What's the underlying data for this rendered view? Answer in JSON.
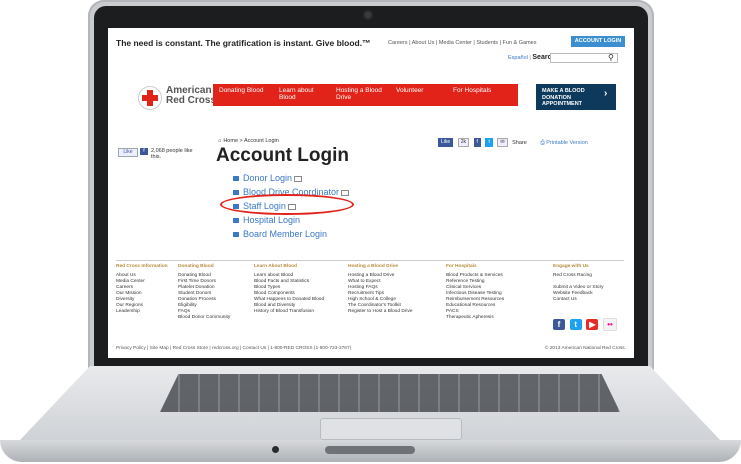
{
  "site": {
    "tagline": "The need is constant. The gratification is instant. Give blood.™",
    "top_links": "Careers | About Us | Media Center | Students | Fun & Games",
    "account_login": "ACCOUNT LOGIN",
    "espanol": "Español",
    "search_label": "Search",
    "logo_line1": "American",
    "logo_line2": "Red Cross",
    "nav": [
      {
        "label": "Donating Blood"
      },
      {
        "label": "Learn about Blood"
      },
      {
        "label": "Hosting a Blood Drive"
      },
      {
        "label": "Volunteer"
      },
      {
        "label": "For Hospitals"
      }
    ],
    "cta": "MAKE A BLOOD DONATION APPOINTMENT",
    "fb_like": "Like",
    "people_like": "2,068 people like this.",
    "breadcrumb": "Home > Account Login",
    "page_title": "Account Login",
    "share": {
      "like": "Like",
      "count": "2k",
      "share": "Share",
      "printable": "Printable Version"
    },
    "login_options": [
      {
        "label": "Donor Login"
      },
      {
        "label": "Blood Drive Coordinator"
      },
      {
        "label": "Staff Login"
      },
      {
        "label": "Hospital Login"
      },
      {
        "label": "Board Member Login"
      }
    ],
    "footer": {
      "columns": [
        {
          "head": "Red Cross Information",
          "items": [
            "About Us",
            "Media Center",
            "Careers",
            "Our Mission",
            "Diversity",
            "Our Regions",
            "Leadership"
          ]
        },
        {
          "head": "Donating Blood",
          "items": [
            "Donating Blood",
            "First Time Donors",
            "Platelet Donation",
            "Student Donors",
            "Donation Process",
            "Eligibility",
            "FAQs",
            "Blood Donor Community"
          ]
        },
        {
          "head": "Learn About Blood",
          "items": [
            "Learn about Blood",
            "Blood Facts and Statistics",
            "Blood Types",
            "Blood Components",
            "What Happens to Donated Blood",
            "Blood and Diversity",
            "History of Blood Transfusion"
          ]
        },
        {
          "head": "Hosting a Blood Drive",
          "items": [
            "Hosting a Blood Drive",
            "What to Expect",
            "Hosting FAQs",
            "Recruitment Tips",
            "High School & College",
            "The Coordinator's Toolkit",
            "Register to Host a Blood Drive"
          ]
        },
        {
          "head": "For Hospitals",
          "items": [
            "Blood Products & Services",
            "Reference Testing",
            "Clinical Services",
            "Infectious Disease Testing",
            "Reimbursement Resources",
            "Educational Resources",
            "PACS",
            "Therapeutic Apheresis"
          ]
        },
        {
          "head": "Engage with Us",
          "items": [
            "Red Cross Racing",
            "",
            "Submit a Video or Story",
            "Website Feedback",
            "Contact Us"
          ]
        }
      ]
    },
    "legal": "Privacy Policy | Site Map | Red Cross Store | redcross.org | Contact Us | 1-800-RED CROSS (1-800-733-2767)",
    "copyright": "© 2013 American National Red Cross."
  }
}
